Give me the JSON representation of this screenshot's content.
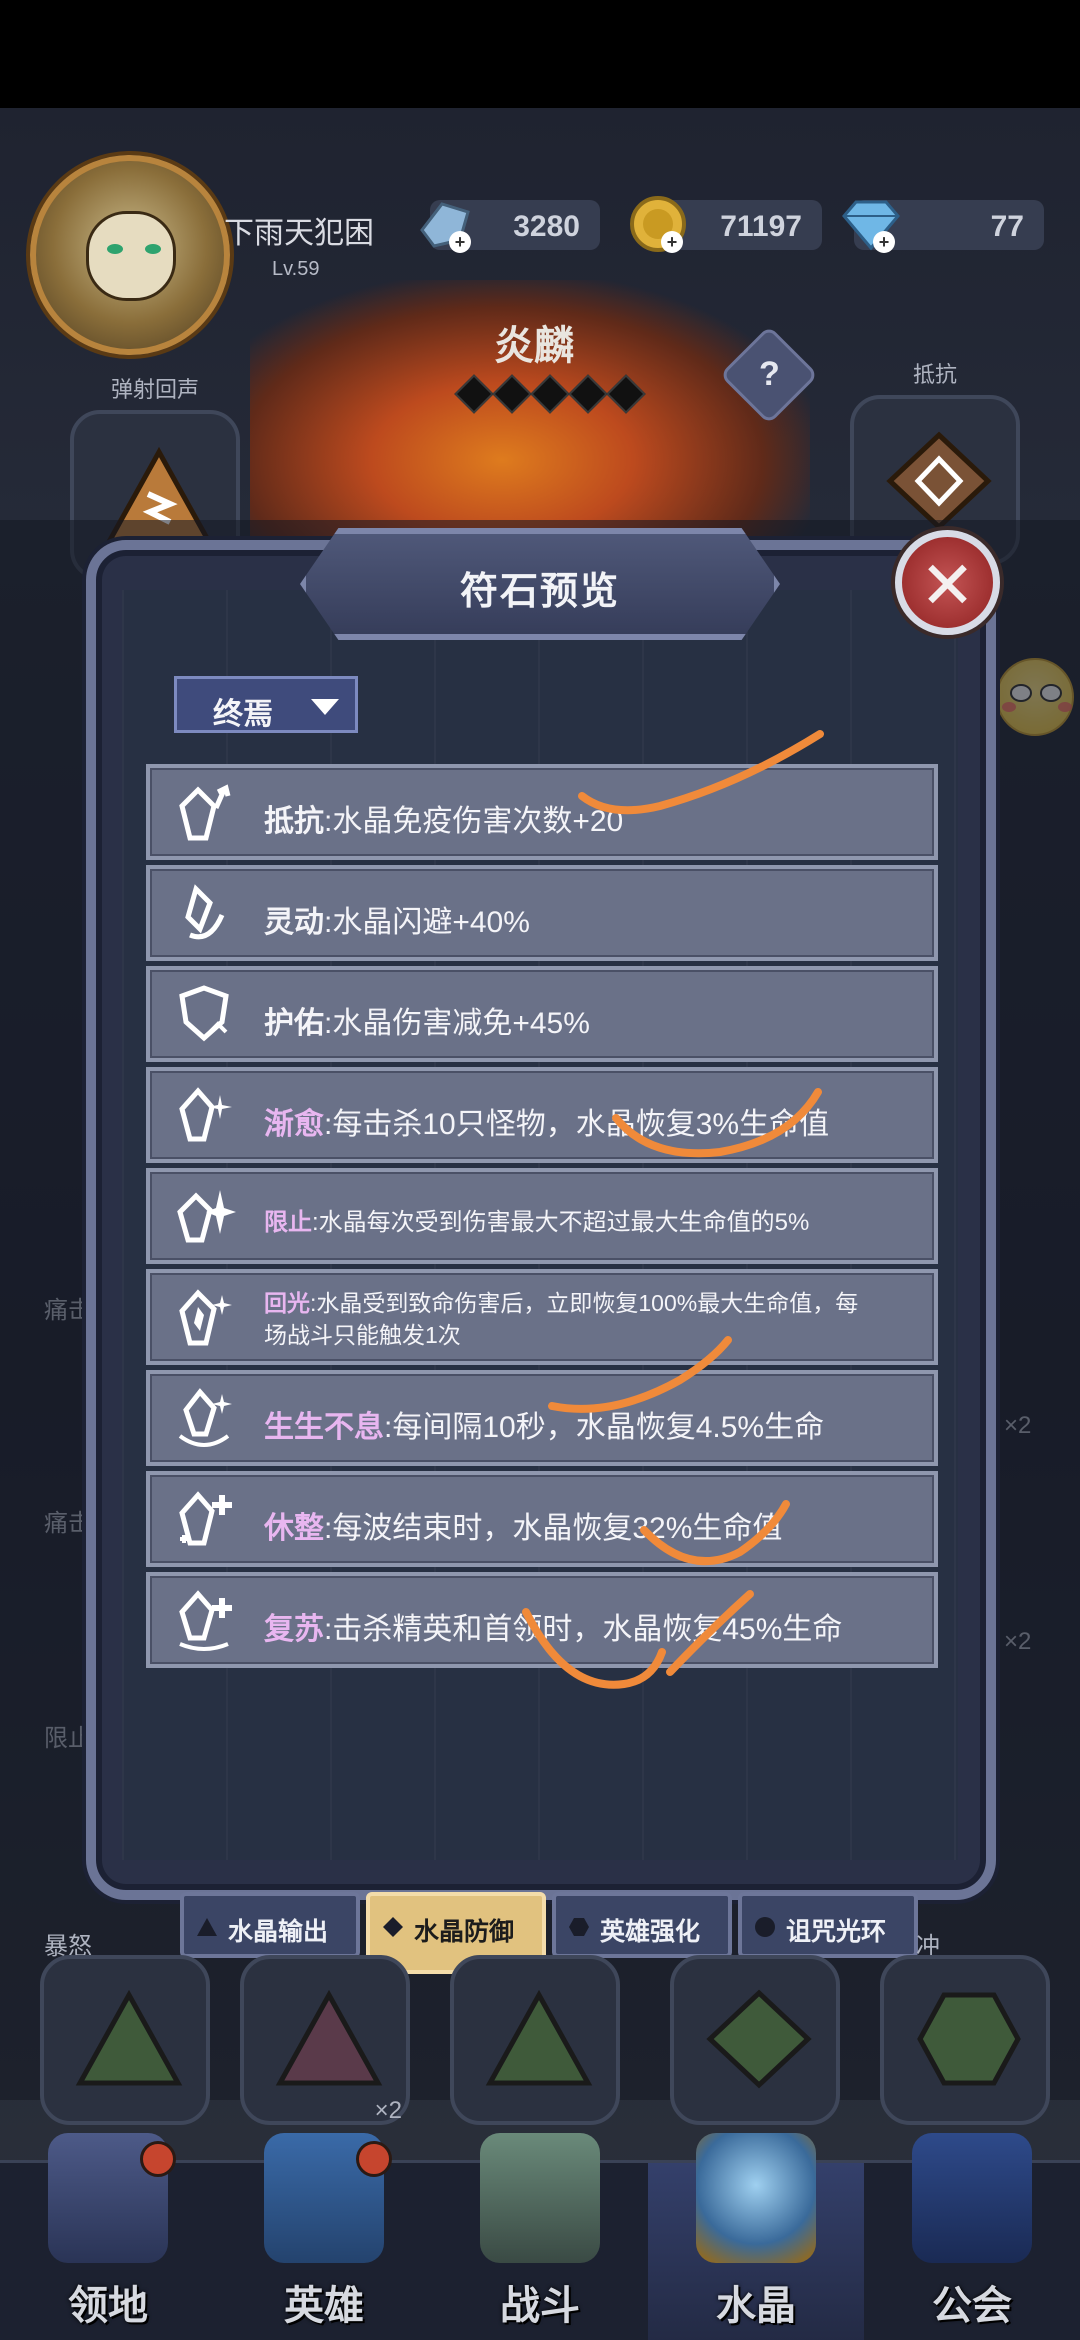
{
  "player": {
    "name": "下雨天犯困",
    "level": "Lv.59"
  },
  "resources": [
    {
      "icon": "crystal-shard-icon",
      "value": "3280"
    },
    {
      "icon": "gold-coin-icon",
      "value": "71197"
    },
    {
      "icon": "diamond-icon",
      "value": "77"
    }
  ],
  "boss": {
    "name": "炎麟"
  },
  "top_skills": {
    "left_label": "弹射回声",
    "right_label": "抵抗"
  },
  "modal": {
    "title": "符石预览",
    "close_symbol": "✕",
    "filter": {
      "selected": "终焉"
    },
    "runes": [
      {
        "name": "抵抗",
        "desc": ":水晶免疫伤害次数+20",
        "icon": "crystal-up-arrow-icon",
        "style": "normal"
      },
      {
        "name": "灵动",
        "desc": ":水晶闪避+40%",
        "icon": "crystal-dodge-icon",
        "style": "normal"
      },
      {
        "name": "护佑",
        "desc": ":水晶伤害减免+45%",
        "icon": "crystal-shield-icon",
        "style": "normal"
      },
      {
        "name": "渐愈",
        "desc": ":每击杀10只怪物，水晶恢复3%生命值",
        "icon": "crystal-sparkle-icon",
        "style": "normal"
      },
      {
        "name": "限止",
        "desc": ":水晶每次受到伤害最大不超过最大生命值的5%",
        "icon": "crystal-burst-icon",
        "style": "small"
      },
      {
        "name": "回光",
        "desc": ":水晶受到致命伤害后，立即恢复100%最大生命值，每场战斗只能触发1次",
        "icon": "crystal-glow-icon",
        "style": "two"
      },
      {
        "name": "生生不息",
        "desc": ":每间隔10秒，水晶恢复4.5%生命",
        "icon": "crystal-cycle-icon",
        "style": "normal"
      },
      {
        "name": "休整",
        "desc": ":每波结束时，水晶恢复32%生命值",
        "icon": "crystal-plus-icon",
        "style": "normal"
      },
      {
        "name": "复苏",
        "desc": ":击杀精英和首领时，水晶恢复45%生命",
        "icon": "crystal-revive-icon",
        "style": "normal"
      }
    ],
    "tabs": [
      {
        "label": "水晶输出",
        "icon": "triangle-icon",
        "active": false
      },
      {
        "label": "水晶防御",
        "icon": "diamond-icon",
        "active": true
      },
      {
        "label": "英雄强化",
        "icon": "hexagon-icon",
        "active": false
      },
      {
        "label": "诅咒光环",
        "icon": "circle-icon",
        "active": false
      }
    ]
  },
  "side_labels": {
    "rage": "暴怒",
    "pain1": "痛击",
    "pain2": "痛击",
    "limit": "限止",
    "rush": "冲",
    "x2": "×2"
  },
  "nav": [
    {
      "label": "领地",
      "active": false
    },
    {
      "label": "英雄",
      "active": false
    },
    {
      "label": "战斗",
      "active": false
    },
    {
      "label": "水晶",
      "active": true
    },
    {
      "label": "公会",
      "active": false
    }
  ],
  "colors": {
    "accent_gold": "#e1c27f",
    "close_red": "#b24040",
    "panel": "#2a3047",
    "rune_row": "#6a7188"
  }
}
